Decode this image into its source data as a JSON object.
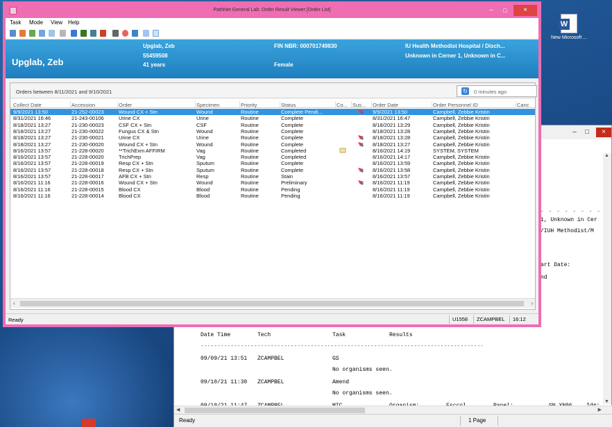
{
  "desktop": {
    "word_icon_label": "New Microsoft ..."
  },
  "doc_window": {
    "controls": {
      "min": "–",
      "max": "□",
      "close": "×"
    },
    "right_text": [
      "1, Unknown in Cer",
      "/IUH Methodist/M",
      "art Date:",
      "nd"
    ],
    "results_header": {
      "datetime": "Date Time",
      "tech": "Tech",
      "task": "Task",
      "results": "Results"
    },
    "results_rows": [
      {
        "datetime": "09/09/21 13:51",
        "tech": "ZCAMPBEL",
        "task": "GS",
        "results": ""
      },
      {
        "datetime": "",
        "tech": "",
        "task": "No organisms seen.",
        "results": ""
      },
      {
        "datetime": "09/10/21 11:30",
        "tech": "ZCAMPBEL",
        "task": "Amend",
        "results": ""
      },
      {
        "datetime": "",
        "tech": "",
        "task": "No organisms seen.",
        "results": ""
      },
      {
        "datetime": "09/10/21 11:47",
        "tech": "ZCAMPBEL",
        "task": "MIC",
        "results": "Organism:"
      }
    ],
    "last_row_extra": {
      "org": "Esccol",
      "panel_label": "Panel:",
      "panel": "GN XN06",
      "id": "Id#:"
    },
    "status": {
      "ready": "Ready",
      "page": "1 Page"
    }
  },
  "main_window": {
    "title": "PathNet General Lab: Order Result Viewer [Order List]",
    "controls": {
      "min": "–",
      "max": "□",
      "close": "×"
    },
    "menu": [
      "Task",
      "Mode",
      "View",
      "Help"
    ],
    "patient": {
      "name_header": "Upglab, Zeb",
      "name_small": "Upglab, Zeb",
      "mrn": "55459508",
      "age": "41 years",
      "fin": "FIN NBR: 000701749830",
      "sex": "Female",
      "facility": "IU Health Methodist Hospital / Disch...",
      "location": "Unknown in Cerner 1, Unknown in C..."
    },
    "orders_range": "Orders between 8/11/2021 and 9/10/2021",
    "refresh_text": "0 minutes ago",
    "columns": [
      "Collect Date",
      "Accession",
      "Order",
      "Specimen",
      "Priority",
      "Status",
      "Co...",
      "Sus...",
      "Order Date",
      "Order Personnel ID",
      "Canc"
    ],
    "rows": [
      {
        "collect": "9/9/2021 13:50",
        "accession": "21-252-00023",
        "order": "Wound CX + Stn",
        "specimen": "Wound",
        "priority": "Routine",
        "status": "Complete Pendi...",
        "order_date": "9/9/2021 13:50",
        "personnel": "Campbell, Zebbie Kristin",
        "flag": "sus"
      },
      {
        "collect": "8/31/2021 16:46",
        "accession": "21-243-00106",
        "order": "Urine CX",
        "specimen": "Urine",
        "priority": "Routine",
        "status": "Complete",
        "order_date": "8/31/2021 16:47",
        "personnel": "Campbell, Zebbie Kristin",
        "flag": ""
      },
      {
        "collect": "8/18/2021 13:27",
        "accession": "21-230-00023",
        "order": "CSF CX + Stn",
        "specimen": "CSF",
        "priority": "Routine",
        "status": "Complete",
        "order_date": "8/18/2021 13:29",
        "personnel": "Campbell, Zebbie Kristin",
        "flag": ""
      },
      {
        "collect": "8/18/2021 13:27",
        "accession": "21-230-00022",
        "order": "Fungus CX & Stn",
        "specimen": "Wound",
        "priority": "Routine",
        "status": "Complete",
        "order_date": "8/18/2021 13:28",
        "personnel": "Campbell, Zebbie Kristin",
        "flag": ""
      },
      {
        "collect": "8/18/2021 13:27",
        "accession": "21-230-00021",
        "order": "Urine CX",
        "specimen": "Urine",
        "priority": "Routine",
        "status": "Complete",
        "order_date": "8/18/2021 13:28",
        "personnel": "Campbell, Zebbie Kristin",
        "flag": "sus"
      },
      {
        "collect": "8/18/2021 13:27",
        "accession": "21-230-00020",
        "order": "Wound CX + Stn",
        "specimen": "Wound",
        "priority": "Routine",
        "status": "Complete",
        "order_date": "8/18/2021 13:27",
        "personnel": "Campbell, Zebbie Kristin",
        "flag": "sus"
      },
      {
        "collect": "8/16/2021 13:57",
        "accession": "21-228-00020",
        "order": "**TrichExm AFFIRM",
        "specimen": "Vag",
        "priority": "Routine",
        "status": "Completed",
        "order_date": "8/16/2021 14:19",
        "personnel": "SYSTEM, SYSTEM",
        "flag": "co"
      },
      {
        "collect": "8/16/2021 13:57",
        "accession": "21-228-00020",
        "order": "TrichPrep",
        "specimen": "Vag",
        "priority": "Routine",
        "status": "Completed",
        "order_date": "8/16/2021 14:17",
        "personnel": "Campbell, Zebbie Kristin",
        "flag": ""
      },
      {
        "collect": "8/16/2021 13:57",
        "accession": "21-228-00019",
        "order": "Resp CX + Stn",
        "specimen": "Sputum",
        "priority": "Routine",
        "status": "Complete",
        "order_date": "8/16/2021 13:59",
        "personnel": "Campbell, Zebbie Kristin",
        "flag": ""
      },
      {
        "collect": "8/16/2021 13:57",
        "accession": "21-228-00018",
        "order": "Resp CX + Stn",
        "specimen": "Sputum",
        "priority": "Routine",
        "status": "Complete",
        "order_date": "8/16/2021 13:58",
        "personnel": "Campbell, Zebbie Kristin",
        "flag": "sus"
      },
      {
        "collect": "8/16/2021 13:57",
        "accession": "21-228-00017",
        "order": "AFB CX + Stn",
        "specimen": "Resp",
        "priority": "Routine",
        "status": "Stain",
        "order_date": "8/16/2021 13:57",
        "personnel": "Campbell, Zebbie Kristin",
        "flag": ""
      },
      {
        "collect": "8/16/2021 11:16",
        "accession": "21-228-00016",
        "order": "Wound CX + Stn",
        "specimen": "Wound",
        "priority": "Routine",
        "status": "Preliminary",
        "order_date": "8/16/2021 11:19",
        "personnel": "Campbell, Zebbie Kristin",
        "flag": "sus"
      },
      {
        "collect": "8/16/2021 11:16",
        "accession": "21-228-00015",
        "order": "Blood CX",
        "specimen": "Blood",
        "priority": "Routine",
        "status": "Pending",
        "order_date": "8/16/2021 11:19",
        "personnel": "Campbell, Zebbie Kristin",
        "flag": ""
      },
      {
        "collect": "8/16/2021 11:16",
        "accession": "21-228-00014",
        "order": "Blood CX",
        "specimen": "Blood",
        "priority": "Routine",
        "status": "Pending",
        "order_date": "8/16/2021 11:19",
        "personnel": "Campbell, Zebbie Kristin",
        "flag": ""
      }
    ],
    "status": {
      "ready": "Ready",
      "user_id": "U1558",
      "user": "ZCAMPBEL",
      "time": "16:12"
    }
  },
  "colors": {
    "window_border": "#ef6db2",
    "banner": "#2b8fd0",
    "selected_row": "#3393df"
  }
}
